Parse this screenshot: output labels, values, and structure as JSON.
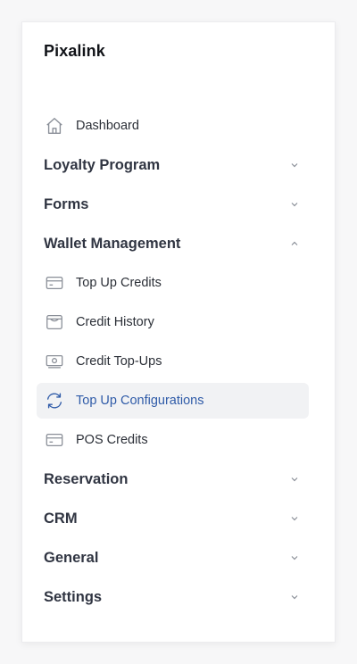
{
  "brand": "Pixalink",
  "nav": {
    "dashboard": "Dashboard",
    "loyalty": "Loyalty Program",
    "forms": "Forms",
    "wallet": "Wallet Management",
    "wallet_items": {
      "top_up_credits": "Top Up Credits",
      "credit_history": "Credit History",
      "credit_top_ups": "Credit Top-Ups",
      "top_up_configurations": "Top Up Configurations",
      "pos_credits": "POS Credits"
    },
    "reservation": "Reservation",
    "crm": "CRM",
    "general": "General",
    "settings": "Settings"
  },
  "colors": {
    "active_text": "#2f5ba8",
    "active_bg": "#f1f2f4",
    "section_text": "#303542"
  },
  "icons": {
    "dashboard": "home-icon",
    "top_up_credits": "card-icon",
    "credit_history": "wallet-icon",
    "credit_top_ups": "cash-icon",
    "top_up_configurations": "refresh-icon",
    "pos_credits": "card-icon",
    "expand": "chevron-down-icon",
    "collapse": "chevron-up-icon"
  }
}
